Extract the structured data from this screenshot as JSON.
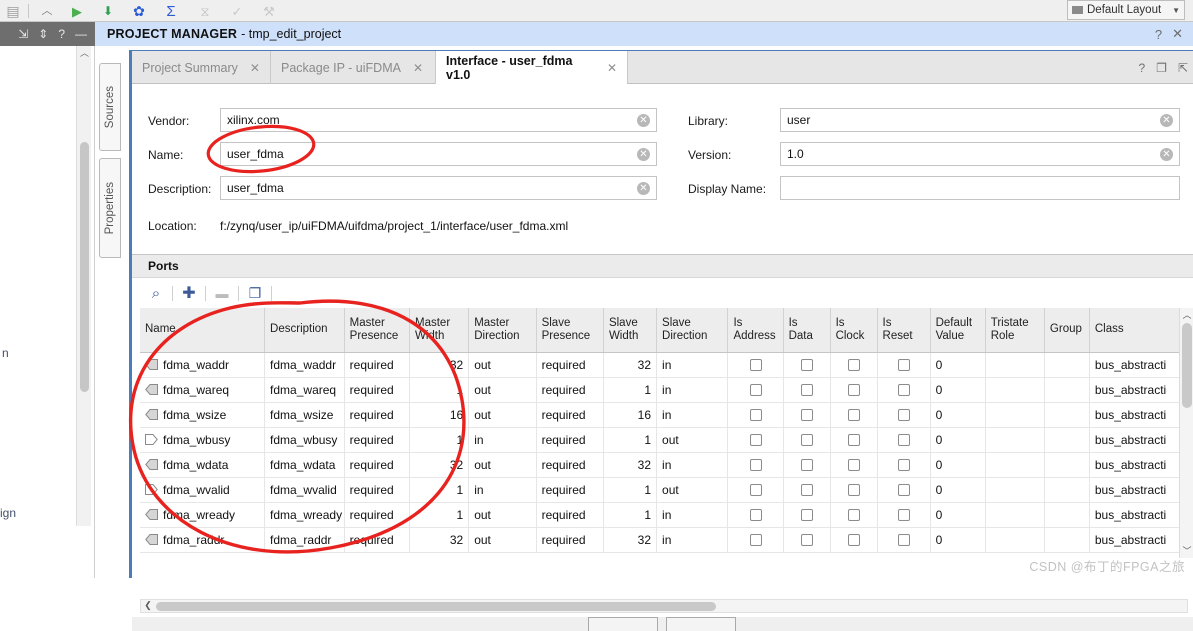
{
  "app_toolbar": {
    "icons": [
      {
        "name": "save-icon",
        "glyph": "▤",
        "color": "#9e9e9e"
      },
      {
        "name": "chevron-up-icon",
        "glyph": "︿",
        "color": "#7d7d7d"
      },
      {
        "name": "run-icon",
        "glyph": "▶",
        "color": "#4caf50"
      },
      {
        "name": "pin-icon",
        "glyph": "⬇",
        "color": "#2e9e4f"
      },
      {
        "name": "settings-gear-icon",
        "glyph": "✿",
        "color": "#2a5bd7"
      },
      {
        "name": "sigma-icon",
        "glyph": "Σ",
        "color": "#2a5bd7"
      },
      {
        "name": "filter-icon",
        "glyph": "⧖",
        "color": "#c4c4c4"
      },
      {
        "name": "check-icon",
        "glyph": "✓",
        "color": "#c9c9c9"
      },
      {
        "name": "bitstream-icon",
        "glyph": "⚒",
        "color": "#c9c9c9"
      }
    ]
  },
  "layout_select": {
    "label": "Default Layout",
    "chevron": "▼"
  },
  "window_strip": {
    "icons": [
      {
        "name": "collapse-all-icon",
        "glyph": "⇲"
      },
      {
        "name": "resize-icon",
        "glyph": "⇕"
      },
      {
        "name": "help-icon",
        "glyph": "?"
      },
      {
        "name": "minimize-icon",
        "glyph": "—"
      }
    ]
  },
  "project_bar": {
    "title": "PROJECT MANAGER",
    "subtitle": "- tmp_edit_project",
    "help_icon": "?",
    "close_icon": "✕"
  },
  "side_tabs": [
    {
      "label": "Sources",
      "name": "sidebar-tab-sources"
    },
    {
      "label": "Properties",
      "name": "sidebar-tab-properties"
    }
  ],
  "background_ghost": {
    "line1": "n",
    "line2": "ign"
  },
  "tabs": [
    {
      "label": "Project Summary",
      "close": "✕",
      "active": false
    },
    {
      "label": "Package IP - uiFDMA",
      "close": "✕",
      "active": false
    },
    {
      "label": "Interface - user_fdma v1.0",
      "close": "✕",
      "active": true
    }
  ],
  "tab_tools": [
    {
      "name": "help-icon",
      "glyph": "?"
    },
    {
      "name": "restore-icon",
      "glyph": "❐"
    },
    {
      "name": "float-icon",
      "glyph": "⇱"
    }
  ],
  "form": {
    "vendor": {
      "label": "Vendor:",
      "value": "xilinx.com",
      "clear": "✕"
    },
    "name": {
      "label": "Name:",
      "value": "user_fdma",
      "clear": "✕"
    },
    "description": {
      "label": "Description:",
      "value": "user_fdma",
      "clear": "✕"
    },
    "location": {
      "label": "Location:",
      "value": "f:/zynq/user_ip/uiFDMA/uifdma/project_1/interface/user_fdma.xml"
    },
    "library": {
      "label": "Library:",
      "value": "user",
      "clear": "✕"
    },
    "version": {
      "label": "Version:",
      "value": "1.0",
      "clear": "✕"
    },
    "display_name": {
      "label": "Display Name:",
      "value": "",
      "placeholder": ""
    }
  },
  "ports": {
    "section_title": "Ports",
    "toolbar": [
      {
        "name": "search-icon",
        "glyph": "⌕",
        "enabled": true
      },
      {
        "name": "add-icon",
        "glyph": "✚",
        "enabled": true
      },
      {
        "name": "remove-icon",
        "glyph": "▬",
        "enabled": false
      },
      {
        "name": "copy-icon",
        "glyph": "❐",
        "enabled": true
      }
    ],
    "columns": [
      "Name",
      "Description",
      "Master Presence",
      "Master Width",
      "Master Direction",
      "Slave Presence",
      "Slave Width",
      "Slave Direction",
      "Is Address",
      "Is Data",
      "Is Clock",
      "Is Reset",
      "Default Value",
      "Tristate Role",
      "Group",
      "Class"
    ],
    "rows": [
      {
        "name": "fdma_waddr",
        "dir_icon": "out",
        "description": "fdma_waddr",
        "master_presence": "required",
        "master_width": "32",
        "master_direction": "out",
        "slave_presence": "required",
        "slave_width": "32",
        "slave_direction": "in",
        "is_address": false,
        "is_data": false,
        "is_clock": false,
        "is_reset": false,
        "default_value": "0",
        "tristate_role": "",
        "group": "",
        "class": "bus_abstracti"
      },
      {
        "name": "fdma_wareq",
        "dir_icon": "out",
        "description": "fdma_wareq",
        "master_presence": "required",
        "master_width": "1",
        "master_direction": "out",
        "slave_presence": "required",
        "slave_width": "1",
        "slave_direction": "in",
        "is_address": false,
        "is_data": false,
        "is_clock": false,
        "is_reset": false,
        "default_value": "0",
        "tristate_role": "",
        "group": "",
        "class": "bus_abstracti"
      },
      {
        "name": "fdma_wsize",
        "dir_icon": "out",
        "description": "fdma_wsize",
        "master_presence": "required",
        "master_width": "16",
        "master_direction": "out",
        "slave_presence": "required",
        "slave_width": "16",
        "slave_direction": "in",
        "is_address": false,
        "is_data": false,
        "is_clock": false,
        "is_reset": false,
        "default_value": "0",
        "tristate_role": "",
        "group": "",
        "class": "bus_abstracti"
      },
      {
        "name": "fdma_wbusy",
        "dir_icon": "in",
        "description": "fdma_wbusy",
        "master_presence": "required",
        "master_width": "1",
        "master_direction": "in",
        "slave_presence": "required",
        "slave_width": "1",
        "slave_direction": "out",
        "is_address": false,
        "is_data": false,
        "is_clock": false,
        "is_reset": false,
        "default_value": "0",
        "tristate_role": "",
        "group": "",
        "class": "bus_abstracti"
      },
      {
        "name": "fdma_wdata",
        "dir_icon": "out",
        "description": "fdma_wdata",
        "master_presence": "required",
        "master_width": "32",
        "master_direction": "out",
        "slave_presence": "required",
        "slave_width": "32",
        "slave_direction": "in",
        "is_address": false,
        "is_data": false,
        "is_clock": false,
        "is_reset": false,
        "default_value": "0",
        "tristate_role": "",
        "group": "",
        "class": "bus_abstracti"
      },
      {
        "name": "fdma_wvalid",
        "dir_icon": "in",
        "description": "fdma_wvalid",
        "master_presence": "required",
        "master_width": "1",
        "master_direction": "in",
        "slave_presence": "required",
        "slave_width": "1",
        "slave_direction": "out",
        "is_address": false,
        "is_data": false,
        "is_clock": false,
        "is_reset": false,
        "default_value": "0",
        "tristate_role": "",
        "group": "",
        "class": "bus_abstracti"
      },
      {
        "name": "fdma_wready",
        "dir_icon": "out",
        "description": "fdma_wready",
        "master_presence": "required",
        "master_width": "1",
        "master_direction": "out",
        "slave_presence": "required",
        "slave_width": "1",
        "slave_direction": "in",
        "is_address": false,
        "is_data": false,
        "is_clock": false,
        "is_reset": false,
        "default_value": "0",
        "tristate_role": "",
        "group": "",
        "class": "bus_abstracti"
      },
      {
        "name": "fdma_raddr",
        "dir_icon": "out",
        "description": "fdma_raddr",
        "master_presence": "required",
        "master_width": "32",
        "master_direction": "out",
        "slave_presence": "required",
        "slave_width": "32",
        "slave_direction": "in",
        "is_address": false,
        "is_data": false,
        "is_clock": false,
        "is_reset": false,
        "default_value": "0",
        "tristate_role": "",
        "group": "",
        "class": "bus_abstracti"
      }
    ]
  },
  "scroll": {
    "up_arrow": "︿",
    "down_arrow": "﹀",
    "left_arrow": "❮",
    "right_arrow": "❯"
  },
  "watermark": "CSDN @布丁的FPGA之旅",
  "annotation_color": "#e8231f"
}
